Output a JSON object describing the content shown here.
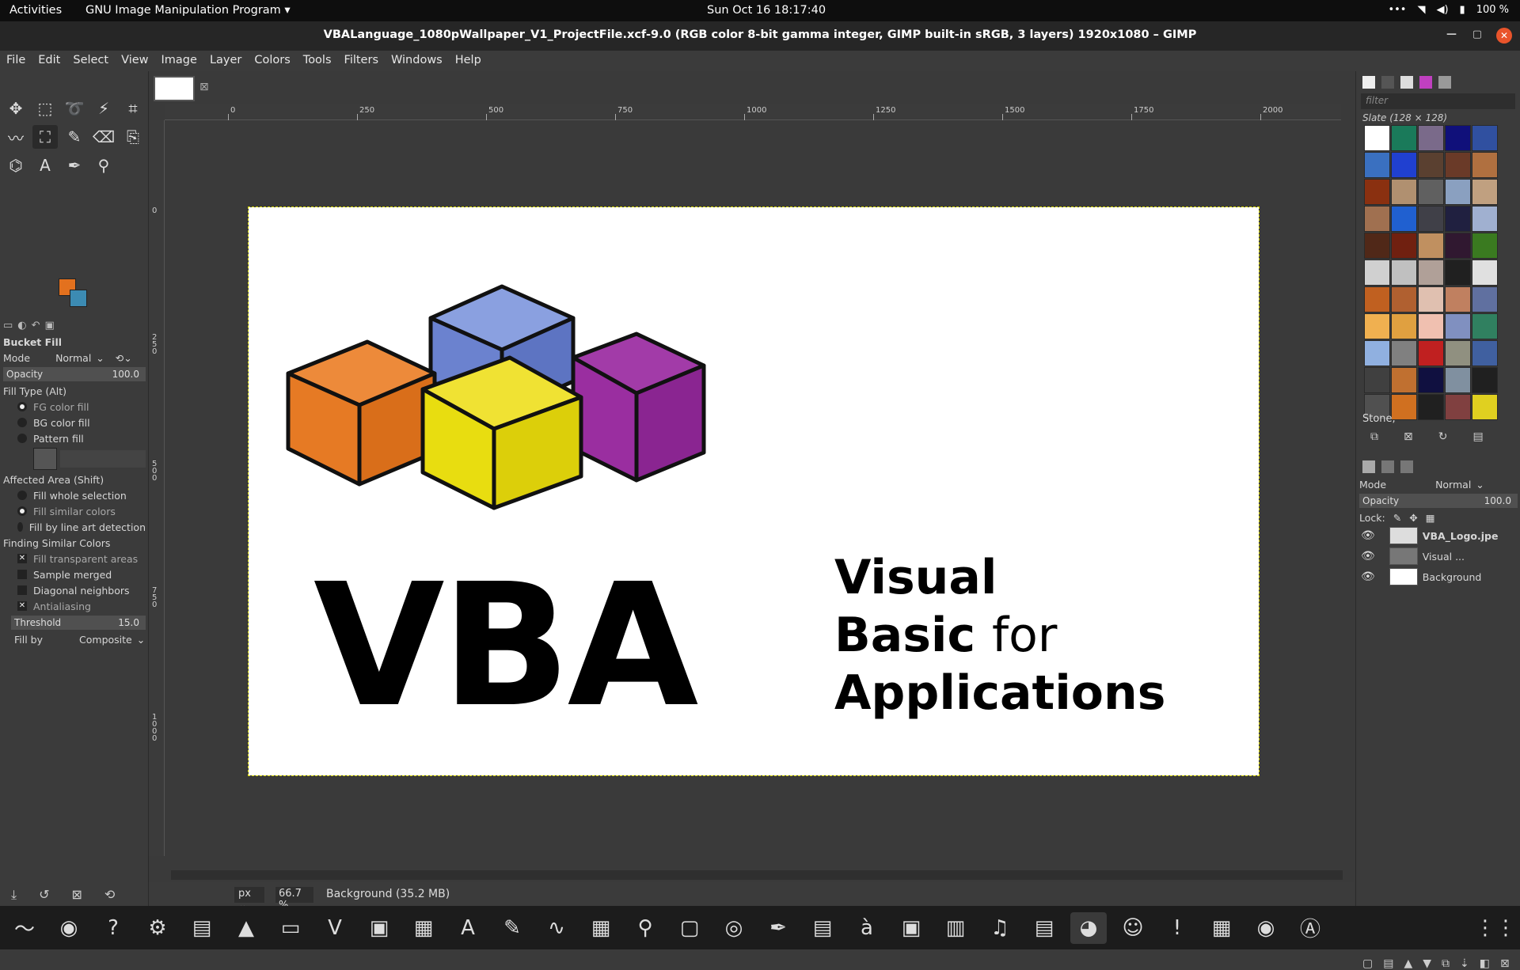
{
  "topbar": {
    "activities": "Activities",
    "app_menu": "GNU Image Manipulation Program ▾",
    "clock": "Sun Oct 16  18:17:40",
    "battery": "100 %"
  },
  "window": {
    "title": "VBALanguage_1080pWallpaper_V1_ProjectFile.xcf-9.0 (RGB color 8-bit gamma integer, GIMP built-in sRGB, 3 layers) 1920x1080 – GIMP"
  },
  "menu": [
    "File",
    "Edit",
    "Select",
    "View",
    "Image",
    "Layer",
    "Colors",
    "Tools",
    "Filters",
    "Windows",
    "Help"
  ],
  "tools": [
    "move-icon",
    "rect-select-icon",
    "lasso-icon",
    "fuzzy-select-icon",
    "crop-icon",
    "transform-icon",
    "warp-icon",
    "bucket-fill-icon",
    "paintbrush-icon",
    "eraser-icon",
    "clone-icon",
    "smudge-icon",
    "paths-icon",
    "text-icon",
    "color-picker-icon",
    "zoom-icon"
  ],
  "colors": {
    "fg": "#e3711e",
    "bg": "#3c8bb3"
  },
  "tool_options": {
    "title": "Bucket Fill",
    "mode_label": "Mode",
    "mode_value": "Normal",
    "opacity_label": "Opacity",
    "opacity_value": "100.0",
    "fill_type_label": "Fill Type  (Alt)",
    "fill_types": [
      "FG color fill",
      "BG color fill",
      "Pattern fill"
    ],
    "affected_label": "Affected Area  (Shift)",
    "affected": [
      "Fill whole selection",
      "Fill similar colors",
      "Fill by line art detection"
    ],
    "similar_label": "Finding Similar Colors",
    "checks": [
      "Fill transparent areas",
      "Sample merged",
      "Diagonal neighbors",
      "Antialiasing"
    ],
    "threshold_label": "Threshold",
    "threshold_value": "15.0",
    "fillby_label": "Fill by",
    "fillby_value": "Composite"
  },
  "ruler": [
    "0",
    "250",
    "500",
    "750",
    "1000",
    "1250",
    "1500",
    "1750",
    "2000"
  ],
  "vruler": [
    "0",
    "2\n5\n0",
    "5\n0\n0",
    "7\n5\n0",
    "1\n0\n0\n0"
  ],
  "image": {
    "big_text": "VBA",
    "line1": "Visual",
    "line2a": "Basic ",
    "line2b": "for",
    "line3": "Applications"
  },
  "status": {
    "unit": "px",
    "zoom": "66.7 %",
    "text": "Background (35.2 MB)"
  },
  "patterns": {
    "filter_placeholder": "filter",
    "title": "Slate (128 × 128)",
    "selected": "Stone,"
  },
  "layers": {
    "mode_label": "Mode",
    "mode_value": "Normal",
    "opacity_label": "Opacity",
    "opacity_value": "100.0",
    "lock_label": "Lock:",
    "items": [
      "VBA_Logo.jpe",
      "Visual ...",
      "Background"
    ]
  }
}
